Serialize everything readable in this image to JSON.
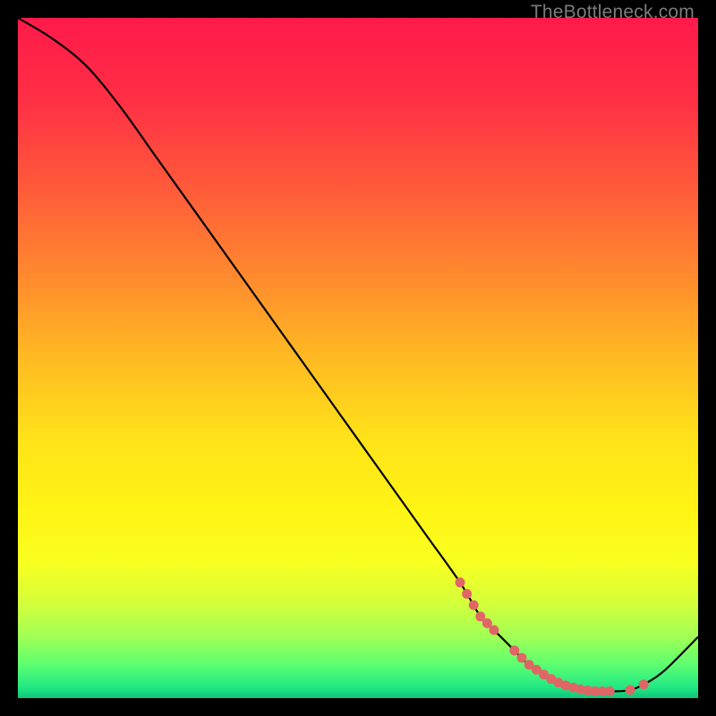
{
  "watermark": "TheBottleneck.com",
  "chart_data": {
    "type": "line",
    "title": "",
    "xlabel": "",
    "ylabel": "",
    "xlim": [
      0,
      100
    ],
    "ylim": [
      0,
      100
    ],
    "x": [
      0,
      5,
      10,
      15,
      20,
      25,
      30,
      35,
      40,
      45,
      50,
      55,
      60,
      65,
      68,
      70,
      72,
      75,
      78,
      80,
      83,
      85,
      88,
      90,
      92,
      95,
      100
    ],
    "values": [
      100,
      97,
      93,
      87,
      80,
      73,
      66,
      59,
      52,
      45,
      38,
      31,
      24,
      17,
      12,
      10,
      8,
      5,
      3,
      2,
      1.2,
      1,
      1,
      1.2,
      2,
      4,
      9
    ],
    "gradient_stops": [
      {
        "offset": 0.0,
        "color": "#ff1a4a"
      },
      {
        "offset": 0.12,
        "color": "#ff2f45"
      },
      {
        "offset": 0.25,
        "color": "#ff5a3a"
      },
      {
        "offset": 0.38,
        "color": "#ff8a2e"
      },
      {
        "offset": 0.5,
        "color": "#ffba22"
      },
      {
        "offset": 0.62,
        "color": "#ffe31a"
      },
      {
        "offset": 0.72,
        "color": "#fff314"
      },
      {
        "offset": 0.8,
        "color": "#f9ff20"
      },
      {
        "offset": 0.86,
        "color": "#d4ff3a"
      },
      {
        "offset": 0.91,
        "color": "#a0ff55"
      },
      {
        "offset": 0.95,
        "color": "#5eff70"
      },
      {
        "offset": 0.985,
        "color": "#20e884"
      },
      {
        "offset": 1.0,
        "color": "#0fc47a"
      }
    ],
    "marker_clusters": [
      {
        "x_start": 65,
        "x_end": 70,
        "count": 6
      },
      {
        "x_start": 73,
        "x_end": 87,
        "count": 14
      },
      {
        "x_start": 90,
        "x_end": 92,
        "count": 2
      }
    ],
    "marker_color": "#e06666",
    "line_color": "#000000"
  }
}
